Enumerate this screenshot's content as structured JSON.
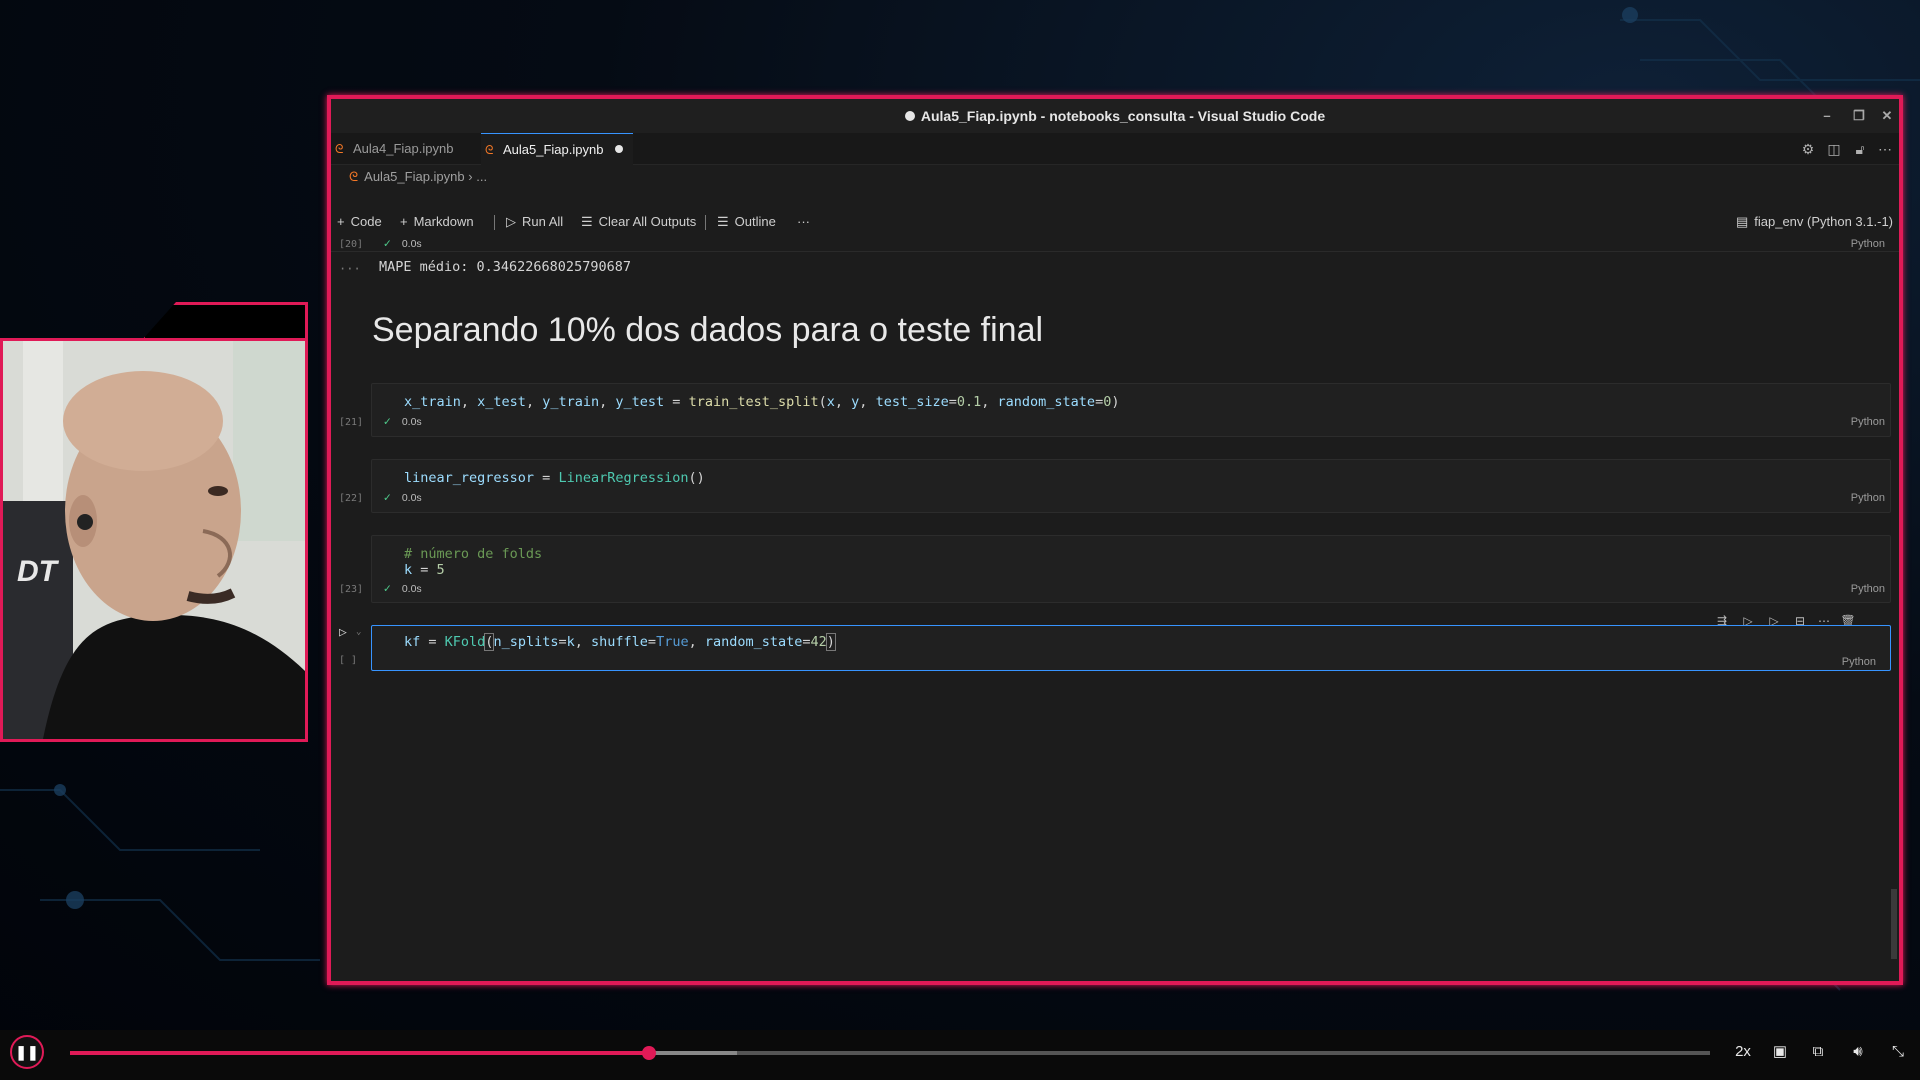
{
  "window": {
    "title": "Aula5_Fiap.ipynb - notebooks_consulta - Visual Studio Code",
    "controls": [
      "–",
      "❐",
      "✕"
    ]
  },
  "tabs": [
    {
      "label": "Aula4_Fiap.ipynb",
      "active": false
    },
    {
      "label": "Aula5_Fiap.ipynb",
      "active": true,
      "modified": true
    }
  ],
  "breadcrumb": {
    "file": "Aula5_Fiap.ipynb",
    "sep": "›",
    "rest": "..."
  },
  "toolbar": {
    "code": "Code",
    "markdown": "Markdown",
    "run_all": "Run All",
    "clear_outputs": "Clear All Outputs",
    "outline": "Outline",
    "more": "···",
    "kernel": "fiap_env (Python 3.1.-1)"
  },
  "cells": {
    "c20": {
      "exec": "[20]",
      "time": "0.0s",
      "lang": "Python"
    },
    "output_prefix": "···",
    "output_text": "MAPE médio: 0.34622668025790687",
    "heading": "Separando 10% dos dados para o teste final",
    "c21": {
      "exec": "[21]",
      "time": "0.0s",
      "lang": "Python",
      "tokens": [
        "x_train",
        ", ",
        "x_test",
        ", ",
        "y_train",
        ", ",
        "y_test",
        " = ",
        "train_test_split",
        "(",
        "x",
        ", ",
        "y",
        ", ",
        "test_size",
        "=",
        "0.1",
        ", ",
        "random_state",
        "=",
        "0",
        ")"
      ]
    },
    "c22": {
      "exec": "[22]",
      "time": "0.0s",
      "lang": "Python",
      "tokens": [
        "linear_regressor",
        " = ",
        "LinearRegression",
        "()"
      ]
    },
    "c23": {
      "exec": "[23]",
      "time": "0.0s",
      "lang": "Python",
      "comment": "# número de folds",
      "tokens": [
        "k",
        " = ",
        "5"
      ]
    },
    "c24": {
      "exec": "[ ]",
      "lang": "Python",
      "tokens": [
        "kf",
        " = ",
        "KFold",
        "(",
        "n_splits",
        "=",
        "k",
        ", ",
        "shuffle",
        "=",
        "True",
        ", ",
        "random_state",
        "=",
        "42",
        ")"
      ]
    }
  },
  "player": {
    "speed": "2x",
    "progress": 0.353,
    "buffered": 0.407
  },
  "colors": {
    "accent": "#e01a57",
    "editor_bg": "#1c1c1c",
    "kernel_ok": "#4ec98a"
  }
}
